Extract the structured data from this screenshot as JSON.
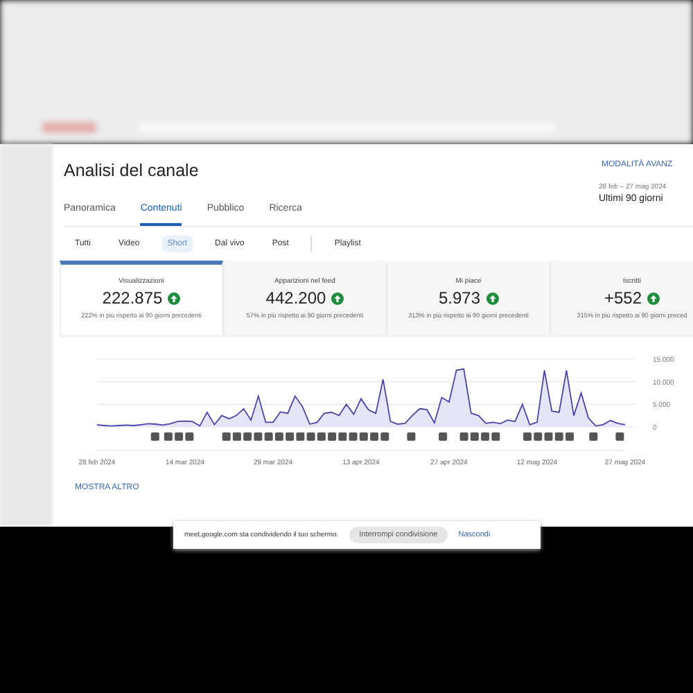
{
  "header": {
    "title": "Analisi del canale",
    "advanced_link": "MODALITÀ AVANZ",
    "date_range": "28 feb – 27 mag 2024",
    "period": "Ultimi 90 giorni"
  },
  "tabs": [
    {
      "label": "Panoramica",
      "selected": false
    },
    {
      "label": "Contenuti",
      "selected": true
    },
    {
      "label": "Pubblico",
      "selected": false
    },
    {
      "label": "Ricerca",
      "selected": false
    }
  ],
  "content_filters": [
    {
      "label": "Tutti",
      "selected": false
    },
    {
      "label": "Video",
      "selected": false
    },
    {
      "label": "Short",
      "selected": true
    },
    {
      "label": "Dal vivo",
      "selected": false
    },
    {
      "label": "Post",
      "selected": false
    },
    {
      "label": "Playlist",
      "selected": false
    }
  ],
  "metrics": [
    {
      "label": "Visualizzazioni",
      "value": "222.875",
      "change": "222% in più rispetto ai 90 giorni precedenti",
      "selected": true
    },
    {
      "label": "Apparizioni nel feed",
      "value": "442.200",
      "change": "57% in più rispetto ai 90 giorni precedenti",
      "selected": false
    },
    {
      "label": "Mi piace",
      "value": "5.973",
      "change": "313% in più rispetto ai 90 giorni precedenti",
      "selected": false
    },
    {
      "label": "Iscritti",
      "value": "+552",
      "change": "315% in più rispetto ai 90 giorni preced",
      "selected": false
    }
  ],
  "chart": {
    "chart_data": {
      "type": "area",
      "categories": [
        "28 feb 2024",
        null,
        null,
        null,
        null,
        null,
        null,
        null,
        null,
        null,
        null,
        null,
        "14 mar 2024",
        null,
        null,
        null,
        null,
        null,
        null,
        null,
        null,
        null,
        null,
        null,
        "29 mar 2024",
        null,
        null,
        null,
        null,
        null,
        null,
        null,
        null,
        null,
        null,
        null,
        "13 apr 2024",
        null,
        null,
        null,
        null,
        null,
        null,
        null,
        null,
        null,
        null,
        null,
        "27 apr 2024",
        null,
        null,
        null,
        null,
        null,
        null,
        null,
        null,
        null,
        null,
        null,
        "12 mag 2024",
        null,
        null,
        null,
        null,
        null,
        null,
        null,
        null,
        null,
        null,
        null,
        "27 mag 2024"
      ],
      "values": [
        500,
        300,
        200,
        300,
        400,
        300,
        500,
        700,
        600,
        400,
        700,
        1200,
        1300,
        1200,
        200,
        3200,
        500,
        2500,
        1800,
        2500,
        4000,
        1500,
        6800,
        1000,
        1000,
        3300,
        3000,
        6800,
        4500,
        600,
        1000,
        3000,
        3200,
        2500,
        5000,
        2800,
        6200,
        3800,
        3000,
        10500,
        1200,
        600,
        800,
        2500,
        4000,
        3800,
        900,
        6500,
        5500,
        12500,
        12800,
        3000,
        2500,
        800,
        1000,
        700,
        1500,
        1200,
        5000,
        500,
        1000,
        12500,
        3500,
        3200,
        12500,
        2500,
        7500,
        2000,
        200,
        500,
        1400,
        800,
        500
      ],
      "ylim": [
        0,
        15000
      ],
      "yticks": [
        {
          "value": 0,
          "label": "0"
        },
        {
          "value": 5000,
          "label": "5.000"
        },
        {
          "value": 10000,
          "label": "10.000"
        },
        {
          "value": 15000,
          "label": "15.000"
        }
      ]
    }
  },
  "show_more": "MOSTRA ALTRO",
  "share_bar": {
    "message": "meet.google.com sta condividendo il tuo schermo.",
    "stop_button": "Interrompi condivisione",
    "hide_link": "Nascondi"
  }
}
